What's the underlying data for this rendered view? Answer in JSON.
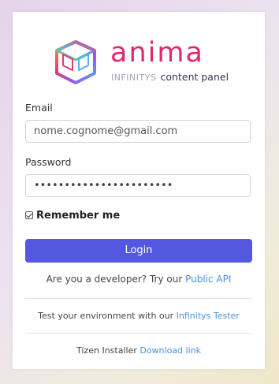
{
  "brand": {
    "name": "anima",
    "sub_prefix": "INFINITYS",
    "sub_suffix": "content panel",
    "color": "#e0296b"
  },
  "form": {
    "email_label": "Email",
    "email_value": "nome.cognome@gmail.com",
    "password_label": "Password",
    "password_value": "•••••••••••••••••••••••",
    "remember_label": "Remember me",
    "remember_checked": true,
    "login_label": "Login",
    "login_color": "#5457e0"
  },
  "developer": {
    "text": "Are you a developer? Try our",
    "link": "Public API"
  },
  "tester": {
    "text": "Test your environment with our",
    "link": "Infinitys Tester"
  },
  "tizen": {
    "text": "Tizen Installer",
    "link": "Download link"
  },
  "colors": {
    "link": "#4a90d9"
  }
}
